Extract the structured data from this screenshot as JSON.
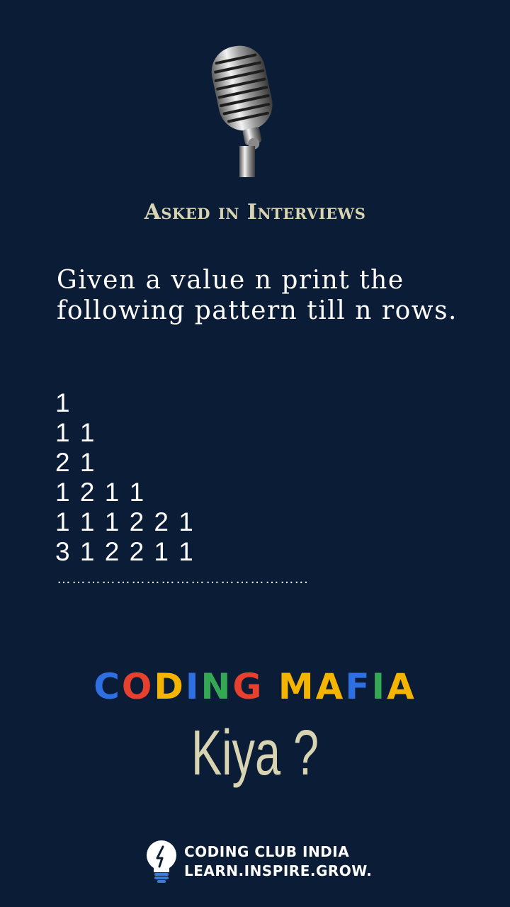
{
  "header": {
    "icon": "microphone-icon",
    "title": "Asked in Interviews"
  },
  "question": {
    "text": "Given a value n print the following pattern till n rows.",
    "pattern_rows": [
      "1",
      "1 1",
      "2 1",
      "1 2 1 1",
      "1 1 1 2 2 1",
      "3 1 2 2 1 1"
    ],
    "continuation": "…………………………………………..."
  },
  "brand": {
    "letters": [
      "C",
      "O",
      "D",
      "I",
      "N",
      "G",
      " ",
      "M",
      "A",
      "F",
      "I",
      "A"
    ],
    "colors": [
      "#2f6fe4",
      "#e8402f",
      "#f5b400",
      "#2f6fe4",
      "#34a853",
      "#e8402f",
      "",
      "#f5b400",
      "#f5b400",
      "#2f6fe4",
      "#34a853",
      "#f5b400"
    ]
  },
  "tagline": "Kiya ?",
  "footer": {
    "icon": "lightbulb-icon",
    "org": "CODING CLUB INDIA",
    "motto": "LEARN.INSPIRE.GROW."
  },
  "colors": {
    "background": "#0b1c36",
    "accent": "#d8d3b0",
    "text": "#ffffff"
  }
}
